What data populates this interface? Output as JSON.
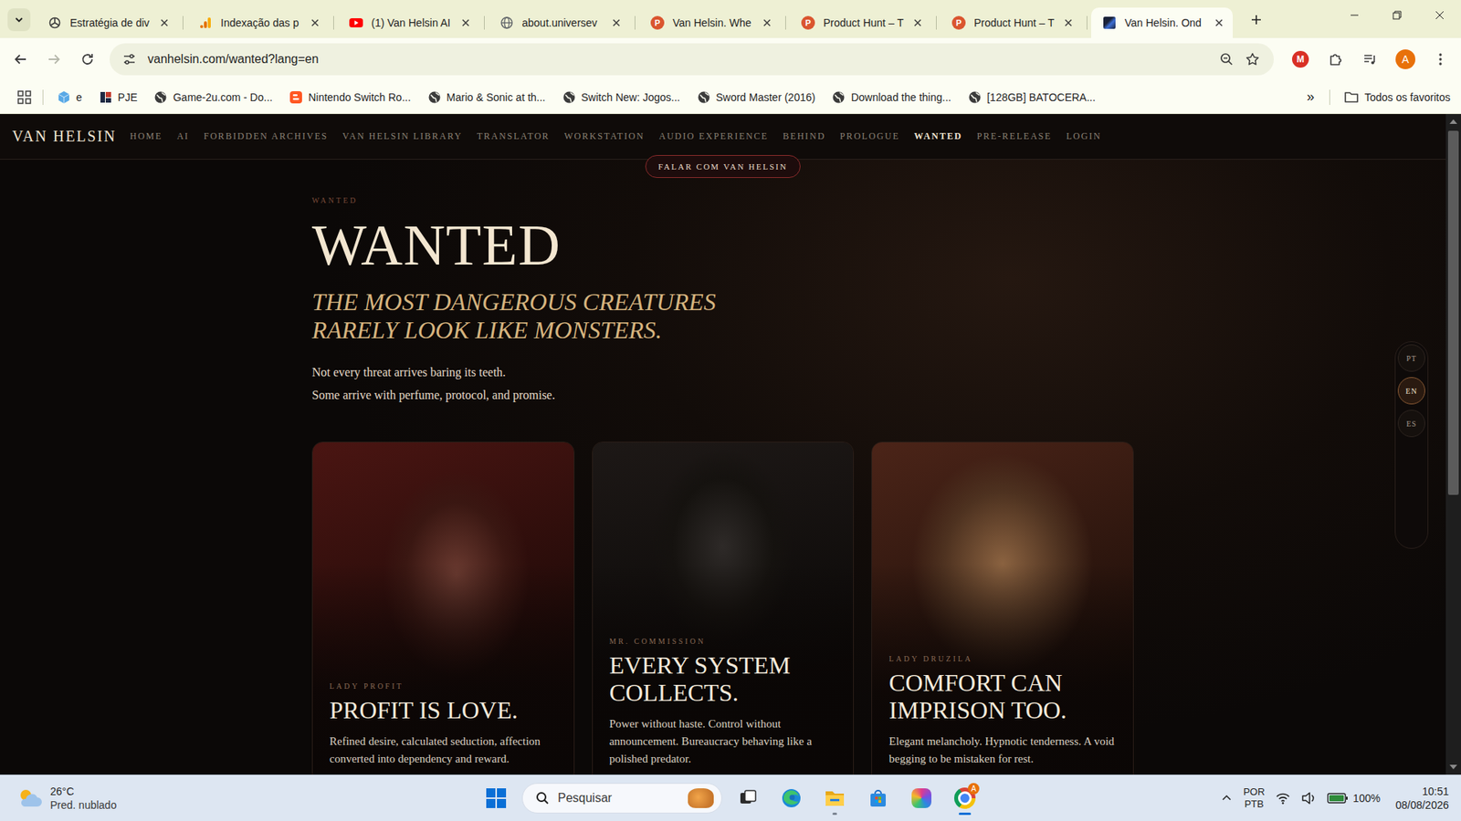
{
  "browser": {
    "tabs": [
      {
        "label": "Estratégia de div",
        "icon": "chatgpt",
        "selected": false
      },
      {
        "label": "Indexação das p",
        "icon": "analytics",
        "selected": false
      },
      {
        "label": "(1) Van Helsin AI",
        "icon": "youtube",
        "selected": false
      },
      {
        "label": "about.universev",
        "icon": "globe",
        "selected": false
      },
      {
        "label": "Van Helsin. Whe",
        "icon": "producthunt",
        "icon_text": "P",
        "selected": false
      },
      {
        "label": "Product Hunt – T",
        "icon": "producthunt",
        "icon_text": "P",
        "selected": false
      },
      {
        "label": "Product Hunt – T",
        "icon": "producthunt",
        "icon_text": "P",
        "selected": false
      },
      {
        "label": "Van Helsin. Ond",
        "icon": "vanhelsin",
        "selected": true
      }
    ],
    "back_enabled": true,
    "forward_enabled": false,
    "address": "vanhelsin.com/wanted?lang=en",
    "zoomed": true,
    "extension_badge": "M",
    "profile_initial": "A",
    "bookmarks": [
      {
        "label": "e",
        "icon": "cube"
      },
      {
        "label": "PJE",
        "icon": "pje"
      },
      {
        "label": "Game-2u.com - Do...",
        "icon": "globe"
      },
      {
        "label": "Nintendo Switch Ro...",
        "icon": "blogger"
      },
      {
        "label": "Mario & Sonic at th...",
        "icon": "globe"
      },
      {
        "label": "Switch New: Jogos...",
        "icon": "globe"
      },
      {
        "label": "Sword Master (2016)",
        "icon": "globe"
      },
      {
        "label": "Download the thing...",
        "icon": "globe"
      },
      {
        "label": "[128GB] BATOCERA...",
        "icon": "globe"
      }
    ],
    "bookmarks_overflow": "»",
    "all_bookmarks": "Todos os favoritos"
  },
  "site": {
    "logo": "VAN HELSIN",
    "nav": [
      {
        "label": "HOME",
        "selected": false
      },
      {
        "label": "AI",
        "selected": false
      },
      {
        "label": "FORBIDDEN ARCHIVES",
        "selected": false
      },
      {
        "label": "VAN HELSIN LIBRARY",
        "selected": false
      },
      {
        "label": "TRANSLATOR",
        "selected": false
      },
      {
        "label": "WORKSTATION",
        "selected": false
      },
      {
        "label": "AUDIO EXPERIENCE",
        "selected": false
      },
      {
        "label": "BEHIND",
        "selected": false
      },
      {
        "label": "PROLOGUE",
        "selected": false
      },
      {
        "label": "WANTED",
        "selected": true
      },
      {
        "label": "PRE-RELEASE",
        "selected": false
      },
      {
        "label": "LOGIN",
        "selected": false
      }
    ],
    "cta": "FALAR COM VAN HELSIN",
    "eyebrow": "WANTED",
    "title": "WANTED",
    "subtitle": [
      "THE MOST DANGEROUS CREATURES",
      "RARELY LOOK LIKE MONSTERS."
    ],
    "intro": [
      "Not every threat arrives baring its teeth.",
      "Some arrive with perfume, protocol, and promise."
    ],
    "cards": [
      {
        "label": "LADY PROFIT",
        "title": "PROFIT IS LOVE.",
        "text": "Refined desire, calculated seduction, affection converted into dependency and reward."
      },
      {
        "label": "MR. COMMISSION",
        "title": "EVERY SYSTEM COLLECTS.",
        "text": "Power without haste. Control without announcement. Bureaucracy behaving like a polished predator."
      },
      {
        "label": "LADY DRUZILA",
        "title": "COMFORT CAN IMPRISON TOO.",
        "text": "Elegant melancholy. Hypnotic tenderness. A void begging to be mistaken for rest."
      }
    ],
    "languages": [
      {
        "code": "PT",
        "selected": false
      },
      {
        "code": "EN",
        "selected": true
      },
      {
        "code": "ES",
        "selected": false
      }
    ],
    "scrollbar": {
      "level": 0.58
    }
  },
  "taskbar": {
    "weather": {
      "temp": "26°C",
      "condition": "Pred. nublado"
    },
    "search": "Pesquisar",
    "apps": [
      {
        "kind": "taskview",
        "running": false,
        "active": false
      },
      {
        "kind": "edge",
        "running": false,
        "active": false
      },
      {
        "kind": "explorer",
        "running": true,
        "active": false
      },
      {
        "kind": "store",
        "running": false,
        "active": false
      },
      {
        "kind": "m365",
        "running": false,
        "active": false
      },
      {
        "kind": "chrome",
        "running": true,
        "active": true,
        "badge": "A"
      }
    ],
    "language": [
      "POR",
      "PTB"
    ],
    "battery": "100%",
    "time": "10:51",
    "date": "08/08/2026"
  }
}
